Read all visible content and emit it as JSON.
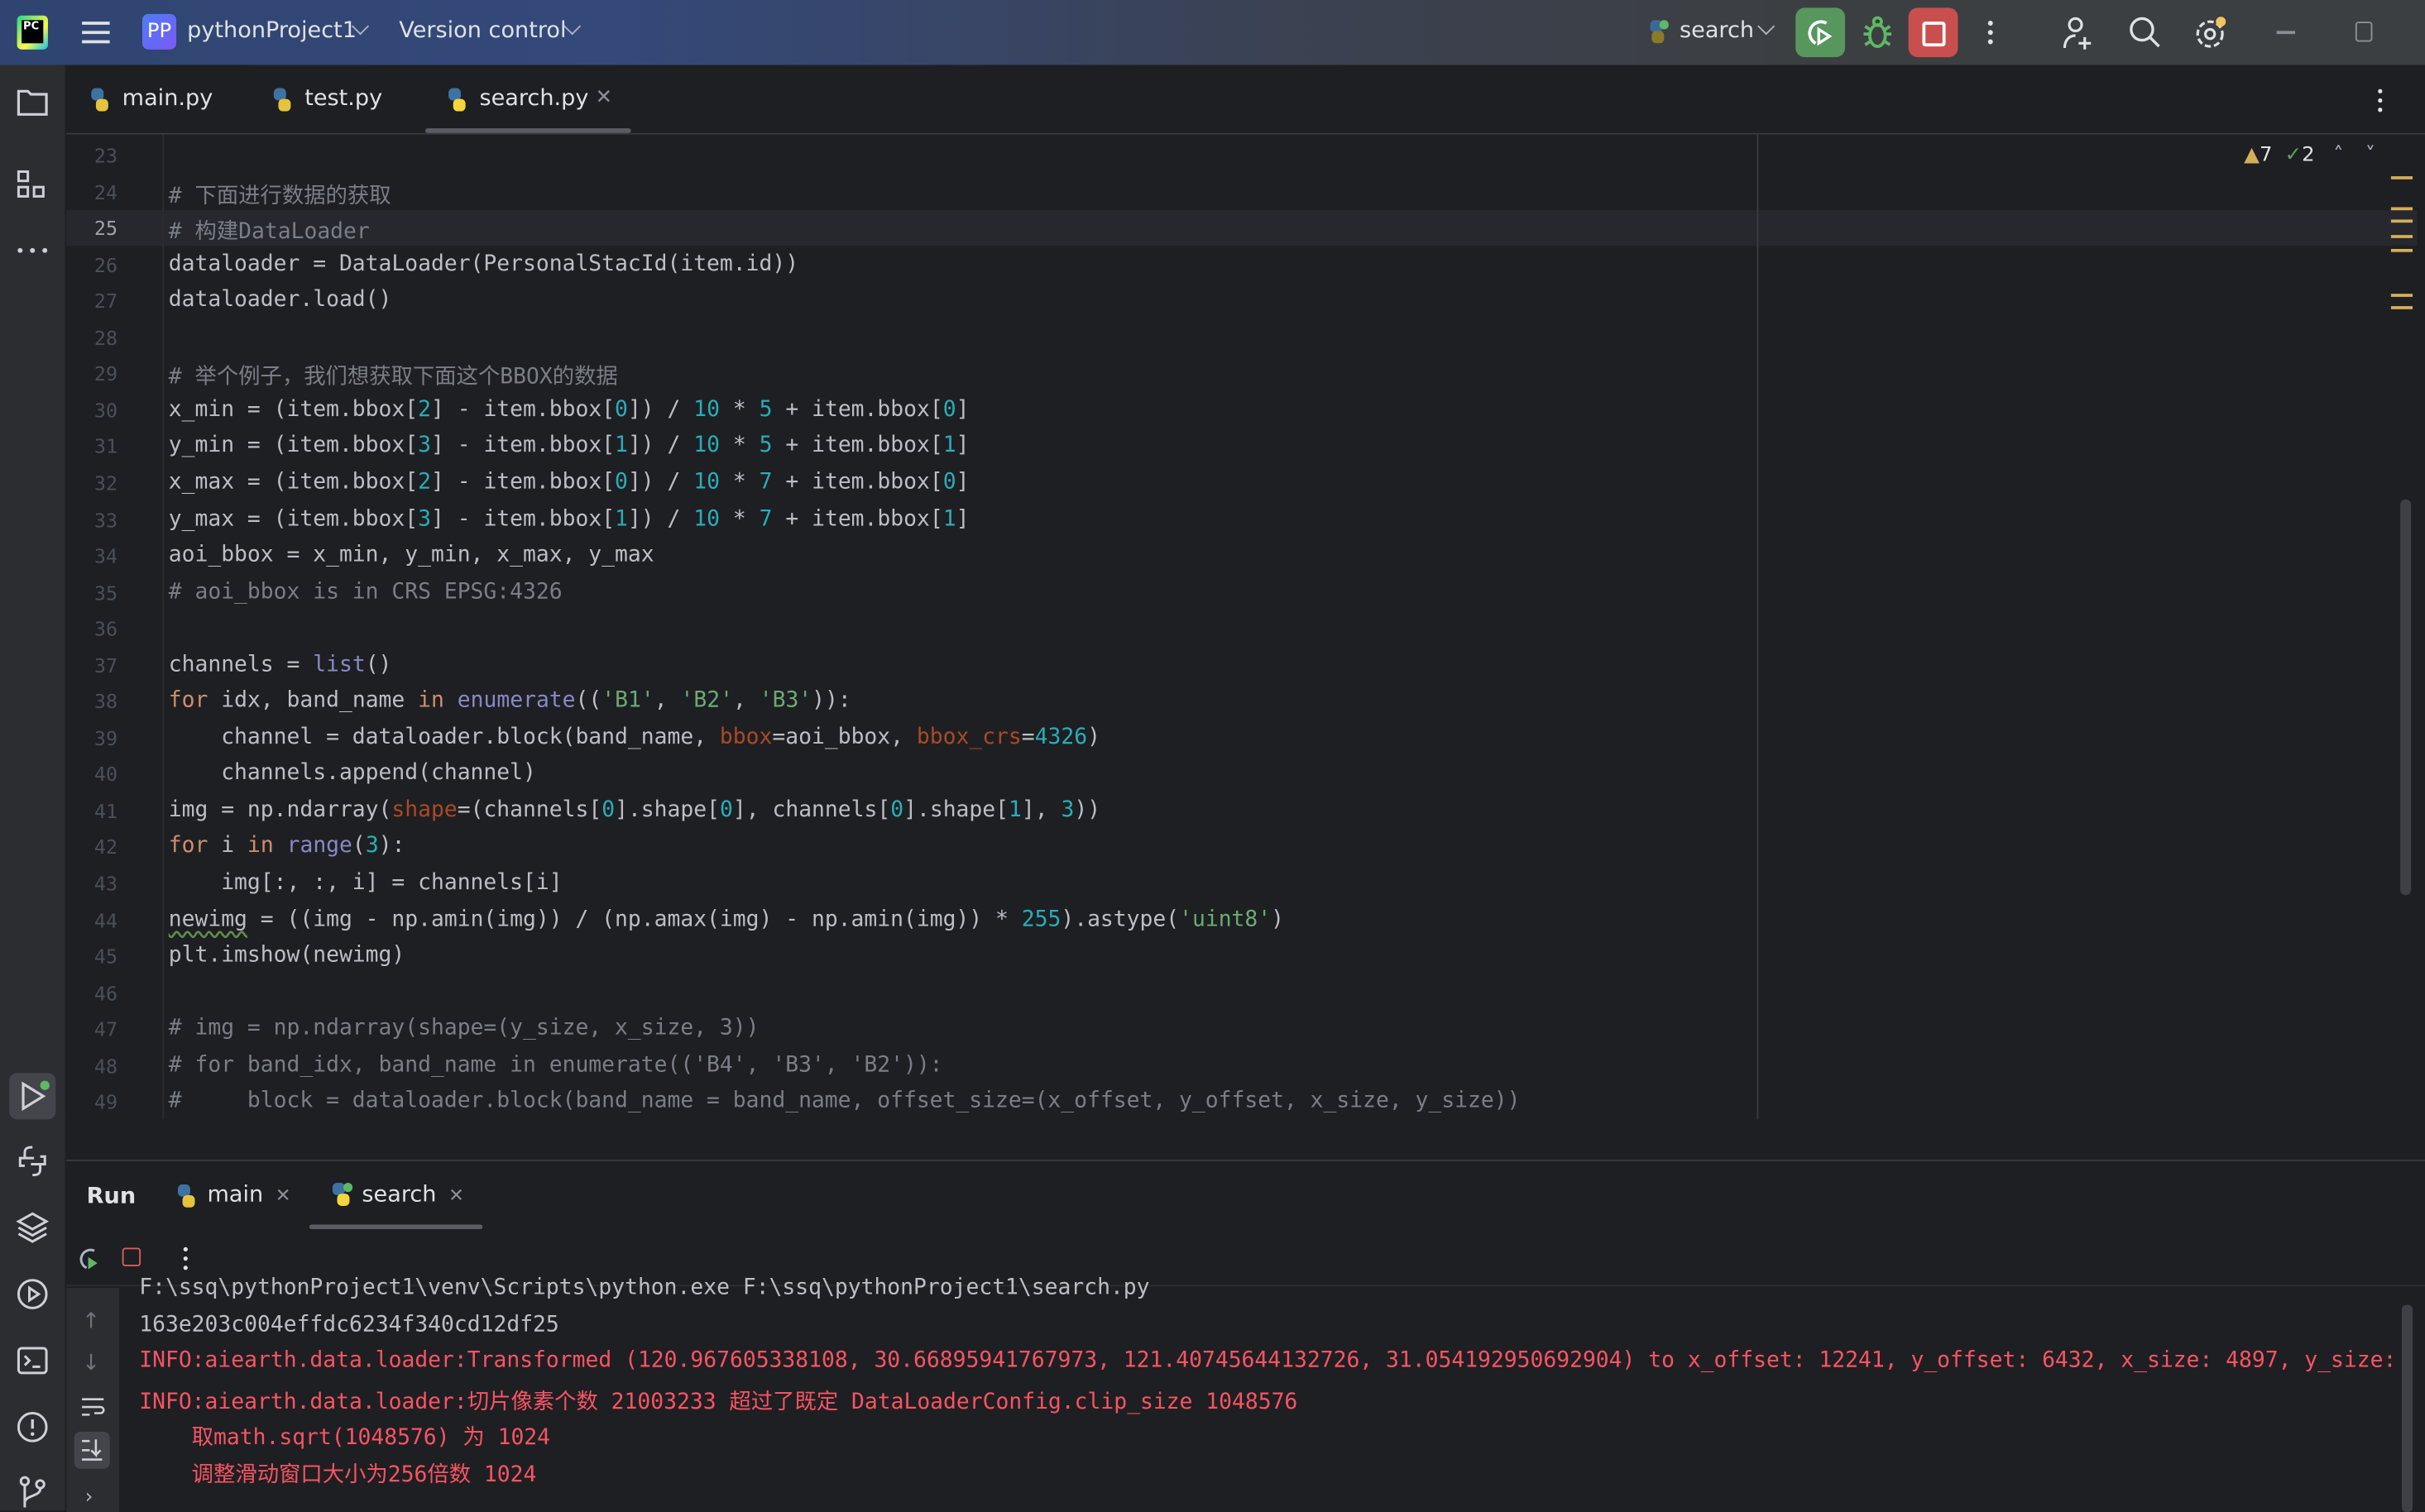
{
  "titlebar": {
    "logo": "PC",
    "project_badge": "PP",
    "project_name": "pythonProject1",
    "vcs_label": "Version control",
    "run_config": "search",
    "colors": {
      "run_rerun_bg": "#57965c",
      "stop_bg": "#c94f4f",
      "debug": "#5fb865",
      "notification_dot": "#f2c55c"
    }
  },
  "tabs": [
    {
      "label": "main.py",
      "active": false
    },
    {
      "label": "test.py",
      "active": false
    },
    {
      "label": "search.py",
      "active": true
    }
  ],
  "inspections": {
    "warnings": "7",
    "weak_warnings": "2"
  },
  "editor": {
    "current_line": 25,
    "lines": [
      {
        "n": "23",
        "tokens": []
      },
      {
        "n": "24",
        "tokens": [
          [
            "# 下面进行数据的获取",
            "cm"
          ]
        ]
      },
      {
        "n": "25",
        "tokens": [
          [
            "# 构建DataLoader",
            "cm"
          ]
        ]
      },
      {
        "n": "26",
        "tokens": [
          [
            "dataloader = DataLoader(PersonalStacId(item.id))",
            ""
          ]
        ]
      },
      {
        "n": "27",
        "tokens": [
          [
            "dataloader.load()",
            ""
          ]
        ]
      },
      {
        "n": "28",
        "tokens": []
      },
      {
        "n": "29",
        "tokens": [
          [
            "# 举个例子，我们想获取下面这个BBOX的数据",
            "cm"
          ]
        ]
      },
      {
        "n": "30",
        "tokens": [
          [
            "x_min = (item.bbox[",
            ""
          ],
          [
            "2",
            "num"
          ],
          [
            "] - item.bbox[",
            ""
          ],
          [
            "0",
            "num"
          ],
          [
            "]) / ",
            ""
          ],
          [
            "10",
            "num"
          ],
          [
            " * ",
            ""
          ],
          [
            "5",
            "num"
          ],
          [
            " + item.bbox[",
            ""
          ],
          [
            "0",
            "num"
          ],
          [
            "]",
            ""
          ]
        ]
      },
      {
        "n": "31",
        "tokens": [
          [
            "y_min = (item.bbox[",
            ""
          ],
          [
            "3",
            "num"
          ],
          [
            "] - item.bbox[",
            ""
          ],
          [
            "1",
            "num"
          ],
          [
            "]) / ",
            ""
          ],
          [
            "10",
            "num"
          ],
          [
            " * ",
            ""
          ],
          [
            "5",
            "num"
          ],
          [
            " + item.bbox[",
            ""
          ],
          [
            "1",
            "num"
          ],
          [
            "]",
            ""
          ]
        ]
      },
      {
        "n": "32",
        "tokens": [
          [
            "x_max = (item.bbox[",
            ""
          ],
          [
            "2",
            "num"
          ],
          [
            "] - item.bbox[",
            ""
          ],
          [
            "0",
            "num"
          ],
          [
            "]) / ",
            ""
          ],
          [
            "10",
            "num"
          ],
          [
            " * ",
            ""
          ],
          [
            "7",
            "num"
          ],
          [
            " + item.bbox[",
            ""
          ],
          [
            "0",
            "num"
          ],
          [
            "]",
            ""
          ]
        ]
      },
      {
        "n": "33",
        "tokens": [
          [
            "y_max = (item.bbox[",
            ""
          ],
          [
            "3",
            "num"
          ],
          [
            "] - item.bbox[",
            ""
          ],
          [
            "1",
            "num"
          ],
          [
            "]) / ",
            ""
          ],
          [
            "10",
            "num"
          ],
          [
            " * ",
            ""
          ],
          [
            "7",
            "num"
          ],
          [
            " + item.bbox[",
            ""
          ],
          [
            "1",
            "num"
          ],
          [
            "]",
            ""
          ]
        ]
      },
      {
        "n": "34",
        "tokens": [
          [
            "aoi_bbox = x_min, y_min, x_max, y_max",
            ""
          ]
        ]
      },
      {
        "n": "35",
        "tokens": [
          [
            "# aoi_bbox is in CRS EPSG:4326",
            "cm"
          ]
        ]
      },
      {
        "n": "36",
        "tokens": []
      },
      {
        "n": "37",
        "tokens": [
          [
            "channels = ",
            ""
          ],
          [
            "list",
            "bi"
          ],
          [
            "()",
            ""
          ]
        ]
      },
      {
        "n": "38",
        "tokens": [
          [
            "for",
            "kw"
          ],
          [
            " idx, band_name ",
            ""
          ],
          [
            "in",
            "kw"
          ],
          [
            " ",
            ""
          ],
          [
            "enumerate",
            "bi"
          ],
          [
            "((",
            ""
          ],
          [
            "'B1'",
            "str"
          ],
          [
            ", ",
            ""
          ],
          [
            "'B2'",
            "str"
          ],
          [
            ", ",
            ""
          ],
          [
            "'B3'",
            "str"
          ],
          [
            ")):",
            ""
          ]
        ]
      },
      {
        "n": "39",
        "tokens": [
          [
            "    channel = dataloader.block(band_name, ",
            ""
          ],
          [
            "bbox",
            "param"
          ],
          [
            "=aoi_bbox, ",
            ""
          ],
          [
            "bbox_crs",
            "param"
          ],
          [
            "=",
            ""
          ],
          [
            "4326",
            "num"
          ],
          [
            ")",
            ""
          ]
        ]
      },
      {
        "n": "40",
        "tokens": [
          [
            "    channels.append(channel)",
            ""
          ]
        ]
      },
      {
        "n": "41",
        "tokens": [
          [
            "img = np.ndarray(",
            ""
          ],
          [
            "shape",
            "param"
          ],
          [
            "=(channels[",
            ""
          ],
          [
            "0",
            "num"
          ],
          [
            "].shape[",
            ""
          ],
          [
            "0",
            "num"
          ],
          [
            "], channels[",
            ""
          ],
          [
            "0",
            "num"
          ],
          [
            "].shape[",
            ""
          ],
          [
            "1",
            "num"
          ],
          [
            "], ",
            ""
          ],
          [
            "3",
            "num"
          ],
          [
            "))",
            ""
          ]
        ]
      },
      {
        "n": "42",
        "tokens": [
          [
            "for",
            "kw"
          ],
          [
            " i ",
            ""
          ],
          [
            "in",
            "kw"
          ],
          [
            " ",
            ""
          ],
          [
            "range",
            "bi"
          ],
          [
            "(",
            ""
          ],
          [
            "3",
            "num"
          ],
          [
            "):",
            ""
          ]
        ]
      },
      {
        "n": "43",
        "tokens": [
          [
            "    img[:, :, i] = channels[i]",
            ""
          ]
        ]
      },
      {
        "n": "44",
        "tokens": [
          [
            "newimg",
            "warn"
          ],
          [
            " = ((img - np.amin(img)) / (np.amax(img) - np.amin(img)) * ",
            ""
          ],
          [
            "255",
            "num"
          ],
          [
            ").astype(",
            ""
          ],
          [
            "'uint8'",
            "str"
          ],
          [
            ")",
            ""
          ]
        ]
      },
      {
        "n": "45",
        "tokens": [
          [
            "plt.imshow(newimg)",
            ""
          ]
        ]
      },
      {
        "n": "46",
        "tokens": []
      },
      {
        "n": "47",
        "tokens": [
          [
            "# img = np.ndarray(shape=(y_size, x_size, 3))",
            "cm"
          ]
        ]
      },
      {
        "n": "48",
        "tokens": [
          [
            "# for band_idx, band_name in enumerate(('B4', 'B3', 'B2')):",
            "cm"
          ]
        ]
      },
      {
        "n": "49",
        "tokens": [
          [
            "#     block = dataloader.block(band_name = band_name, offset_size=(x_offset, y_offset, x_size, y_size))",
            "cm"
          ]
        ]
      }
    ]
  },
  "run_panel": {
    "title": "Run",
    "tabs": [
      {
        "label": "main",
        "active": false
      },
      {
        "label": "search",
        "active": true
      }
    ],
    "console": [
      {
        "text": "F:\\ssq\\pythonProject1\\venv\\Scripts\\python.exe F:\\ssq\\pythonProject1\\search.py",
        "level": "normal"
      },
      {
        "text": "163e203c004effdc6234f340cd12df25",
        "level": "normal"
      },
      {
        "text": "INFO:aiearth.data.loader:Transformed (120.967605338108, 30.66895941767973, 121.40745644132726, 31.054192950692904) to x_offset: 12241, y_offset: 6432, x_size: 4897, y_size:",
        "level": "error"
      },
      {
        "text": "INFO:aiearth.data.loader:切片像素个数 21003233 超过了既定 DataLoaderConfig.clip_size 1048576",
        "level": "error"
      },
      {
        "text": "    取math.sqrt(1048576) 为 1024",
        "level": "error"
      },
      {
        "text": "    调整滑动窗口大小为256倍数 1024",
        "level": "error"
      }
    ]
  }
}
